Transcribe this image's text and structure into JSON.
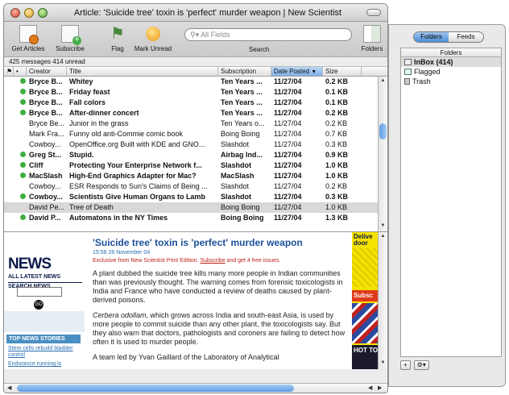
{
  "window": {
    "title": "Article: 'Suicide tree' toxin is 'perfect' murder weapon | New Scientist"
  },
  "toolbar": {
    "get_articles": "Get Articles",
    "subscribe": "Subscribe",
    "flag": "Flag",
    "mark_unread": "Mark Unread",
    "search_placeholder": "All Fields",
    "search_label": "Search",
    "folders": "Folders"
  },
  "status": "425 messages 414 unread",
  "columns": {
    "flag": "",
    "dot": "•",
    "creator": "Creator",
    "title": "Title",
    "subscription": "Subscription",
    "date": "Date Posted",
    "size": "Size"
  },
  "articles": [
    {
      "creator": "Bryce B...",
      "title": "Whitey",
      "subscription": "Ten Years ...",
      "date": "11/27/04",
      "size": "0.2 KB",
      "unread": true
    },
    {
      "creator": "Bryce B...",
      "title": "Friday feast",
      "subscription": "Ten Years ...",
      "date": "11/27/04",
      "size": "0.1 KB",
      "unread": true
    },
    {
      "creator": "Bryce B...",
      "title": "Fall colors",
      "subscription": "Ten Years ...",
      "date": "11/27/04",
      "size": "0.1 KB",
      "unread": true
    },
    {
      "creator": "Bryce B...",
      "title": "After-dinner concert",
      "subscription": "Ten Years ...",
      "date": "11/27/04",
      "size": "0.2 KB",
      "unread": true
    },
    {
      "creator": "Bryce Be...",
      "title": "Junior in the grass",
      "subscription": "Ten Years o...",
      "date": "11/27/04",
      "size": "0.2 KB",
      "unread": false
    },
    {
      "creator": "Mark Fra...",
      "title": "Funny old anti-Commie comic book",
      "subscription": "Boing Boing",
      "date": "11/27/04",
      "size": "0.7 KB",
      "unread": false
    },
    {
      "creator": "Cowboy...",
      "title": "OpenOffice.org Built with KDE and GNO...",
      "subscription": "Slashdot",
      "date": "11/27/04",
      "size": "0.3 KB",
      "unread": false
    },
    {
      "creator": "Greg St...",
      "title": "Stupid.",
      "subscription": "Airbag Ind...",
      "date": "11/27/04",
      "size": "0.9 KB",
      "unread": true
    },
    {
      "creator": "Cliff",
      "title": "Protecting Your Enterprise Network f...",
      "subscription": "Slashdot",
      "date": "11/27/04",
      "size": "1.0 KB",
      "unread": true
    },
    {
      "creator": "MacSlash",
      "title": "High-End Graphics Adapter for Mac?",
      "subscription": "MacSlash",
      "date": "11/27/04",
      "size": "1.0 KB",
      "unread": true
    },
    {
      "creator": "Cowboy...",
      "title": "ESR Responds to Sun's Claims of Being ...",
      "subscription": "Slashdot",
      "date": "11/27/04",
      "size": "0.2 KB",
      "unread": false
    },
    {
      "creator": "Cowboy...",
      "title": "Scientists Give Human Organs to Lamb",
      "subscription": "Slashdot",
      "date": "11/27/04",
      "size": "0.3 KB",
      "unread": true
    },
    {
      "creator": "David Pe...",
      "title": "Tree of Death",
      "subscription": "Boing Boing",
      "date": "11/27/04",
      "size": "1.0 KB",
      "unread": false,
      "selected": true
    },
    {
      "creator": "David P...",
      "title": "Automatons in the NY Times",
      "subscription": "Boing Boing",
      "date": "11/27/04",
      "size": "1.3 KB",
      "unread": true
    }
  ],
  "preview": {
    "logo": "NEWS",
    "all_latest": "ALL LATEST NEWS",
    "search_news": "SEARCH NEWS",
    "go": "GO",
    "top_news": "TOP NEWS STORIES",
    "link1": "Stem cells rebuild bladder control",
    "link2": "Endurance running is",
    "headline": "'Suicide tree' toxin is 'perfect' murder weapon",
    "dateline": "15:56 26 November 04",
    "exclusive_pre": "Exclusive from New Scientist Print Edition.",
    "exclusive_link": "Subscribe",
    "exclusive_post": "and get 4 free issues.",
    "para1": "A plant dubbed the suicide tree kills many more people in Indian communities than was previously thought. The warning comes from forensic toxicologists in India and France who have conducted a review of deaths caused by plant-derived poisons.",
    "para2_italic": "Cerbera odollam",
    "para2": ", which grows across India and south-east Asia, is used by more people to commit suicide than any other plant, the toxicologists say. But they also warn that doctors, pathologists and coroners are failing to detect how often it is used to murder people.",
    "para3": "A team led by Yvan Gaillard of the Laboratory of Analytical",
    "ad1": "Delive door",
    "ad2": "Subsc",
    "ad3": "HOT TO"
  },
  "drawer": {
    "tab_folders": "Folders",
    "tab_feeds": "Feeds",
    "header": "Folders",
    "inbox": "InBox (414)",
    "flagged": "Flagged",
    "trash": "Trash",
    "add": "+",
    "action": "⚙▾"
  }
}
